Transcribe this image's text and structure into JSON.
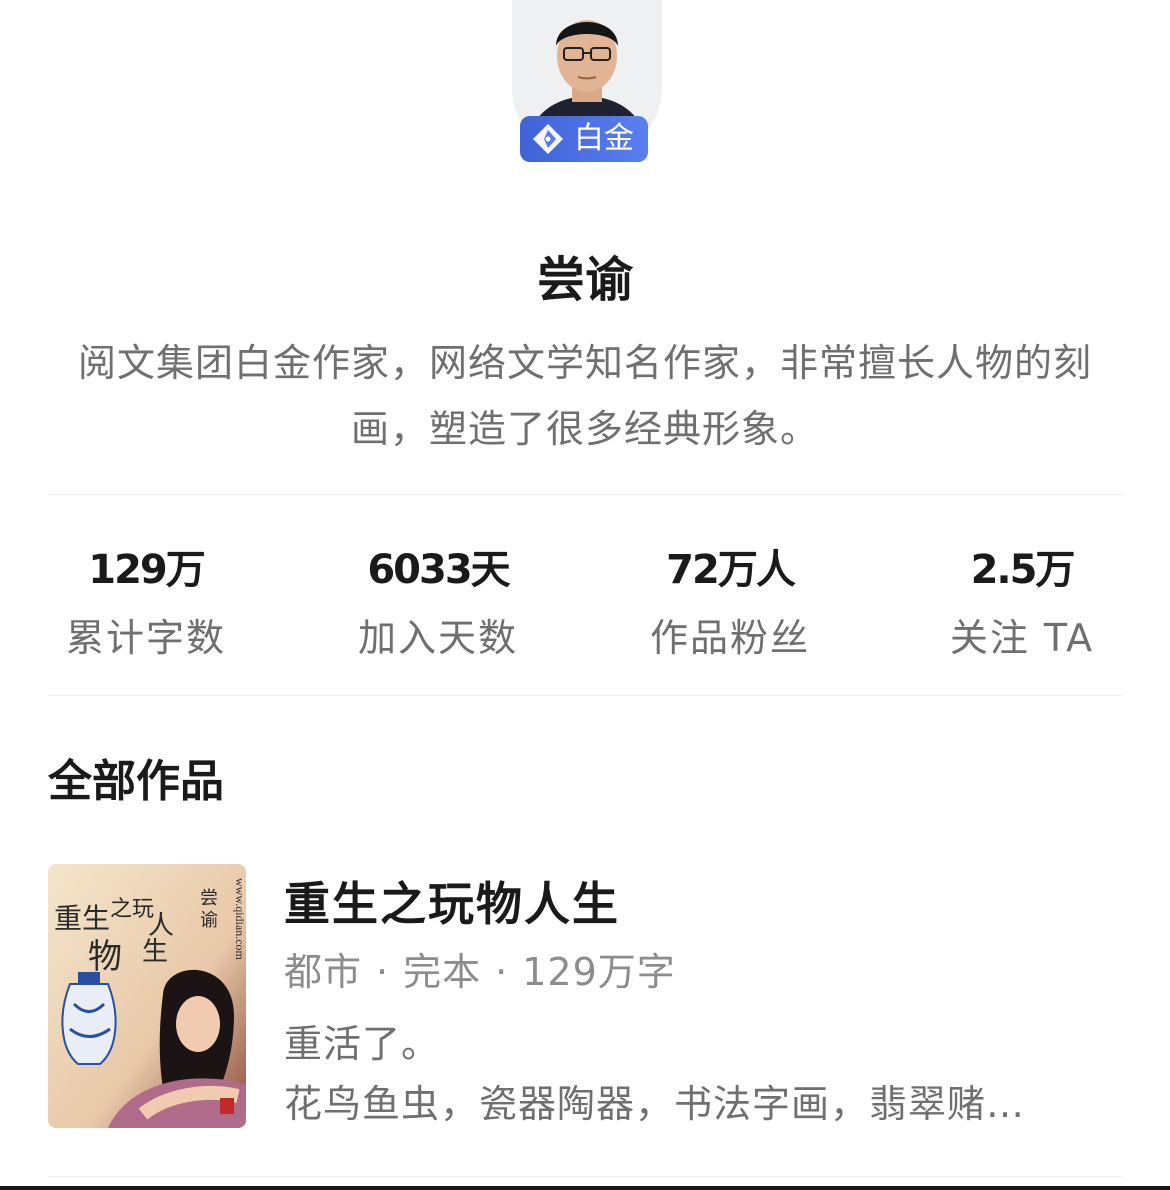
{
  "author": {
    "name": "尝谕",
    "level_badge": "白金",
    "bio": "阅文集团白金作家，网络文学知名作家，非常擅长人物的刻画，塑造了很多经典形象。"
  },
  "stats": [
    {
      "value": "129万",
      "label": "累计字数"
    },
    {
      "value": "6033天",
      "label": "加入天数"
    },
    {
      "value": "72万人",
      "label": "作品粉丝"
    },
    {
      "value": "2.5万",
      "label": "关注 TA"
    }
  ],
  "works": {
    "section_title": "全部作品",
    "books": [
      {
        "title": "重生之玩物人生",
        "genre": "都市",
        "status": "完本",
        "word_count": "129万字",
        "intro": "重活了。",
        "tags": "花鸟鱼虫，瓷器陶器，书法字画，翡翠赌…",
        "cover": {
          "title_text": "重生之玩物人生",
          "author_text": "尝谕",
          "url_text": "www.qidian.com"
        }
      }
    ]
  },
  "colors": {
    "badge": "#4a6ee0",
    "text_primary": "#1a1a1a",
    "text_secondary": "#6f6f6f",
    "text_meta": "#8c8c8c"
  }
}
